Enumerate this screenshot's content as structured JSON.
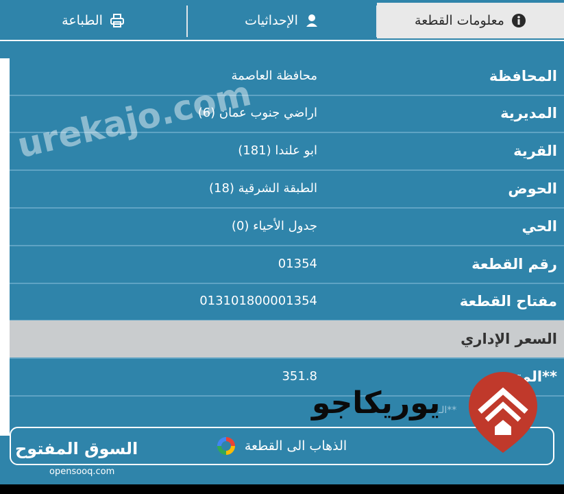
{
  "tabs": [
    {
      "label": "معلومات القطعة",
      "icon": "info-icon",
      "active": true
    },
    {
      "label": "الإحداثيات",
      "icon": "user-pin-icon",
      "active": false
    },
    {
      "label": "الطباعة",
      "icon": "printer-icon",
      "active": false
    }
  ],
  "rows": [
    {
      "label": "المحافظة",
      "value": "محافظة العاصمة"
    },
    {
      "label": "المديرية",
      "value": "اراضي جنوب عمان (6)"
    },
    {
      "label": "القرية",
      "value": "ابو علندا (181)"
    },
    {
      "label": "الحوض",
      "value": "الطبقة الشرقية (18)"
    },
    {
      "label": "الحي",
      "value": "جدول الأحياء (0)"
    },
    {
      "label": "رقم القطعة",
      "value": "01354"
    },
    {
      "label": "مفتاح القطعة",
      "value": "013101800001354"
    }
  ],
  "section": {
    "label": "السعر الإداري"
  },
  "price_row": {
    "label": "**المتر",
    "value": "351.8"
  },
  "note": "**الـ",
  "goto_button": {
    "label": "الذهاب الى القطعة",
    "icon": "google-icon"
  },
  "watermarks": {
    "url": "urekajo.com",
    "logo_text": "يوريكاجو",
    "site_brand": "السوق المفتوح",
    "site_url": "opensooq.com"
  },
  "colors": {
    "background": "#2f84aa",
    "active_tab": "#e9e9e9",
    "section_header": "#c9ccce",
    "badge": "#c0392b"
  }
}
